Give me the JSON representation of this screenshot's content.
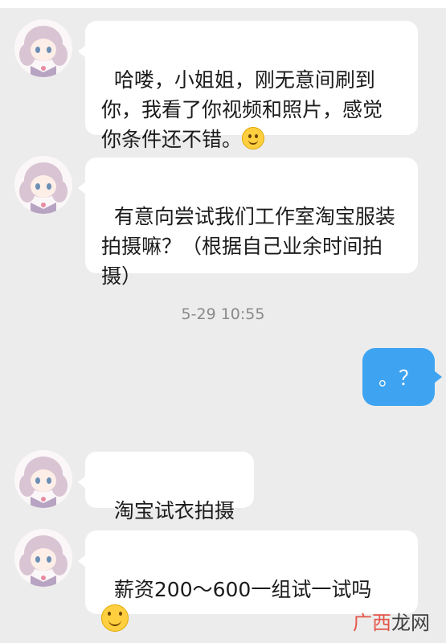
{
  "messages": [
    {
      "from": "other",
      "text": "哈喽，小姐姐，刚无意间刷到你，我看了你视频和照片，感觉你条件还不错。",
      "emoji": "smiling-face-icon"
    },
    {
      "from": "other",
      "text": "有意向尝试我们工作室淘宝服装拍摄嘛？（根据自己业余时间拍摄）"
    },
    {
      "timestamp": "5-29 10:55"
    },
    {
      "from": "me",
      "text": "。？"
    },
    {
      "from": "other",
      "text": "淘宝试衣拍摄"
    },
    {
      "from": "other",
      "text": "薪资200～600一组试一试吗",
      "emoji": "smiling-face-icon"
    }
  ],
  "ui": {
    "bubble_other": "#ffffff",
    "bubble_me": "#3ea4f2",
    "background": "#ececec"
  },
  "watermark": {
    "brand_red": "广西",
    "brand_black": "龙网"
  }
}
